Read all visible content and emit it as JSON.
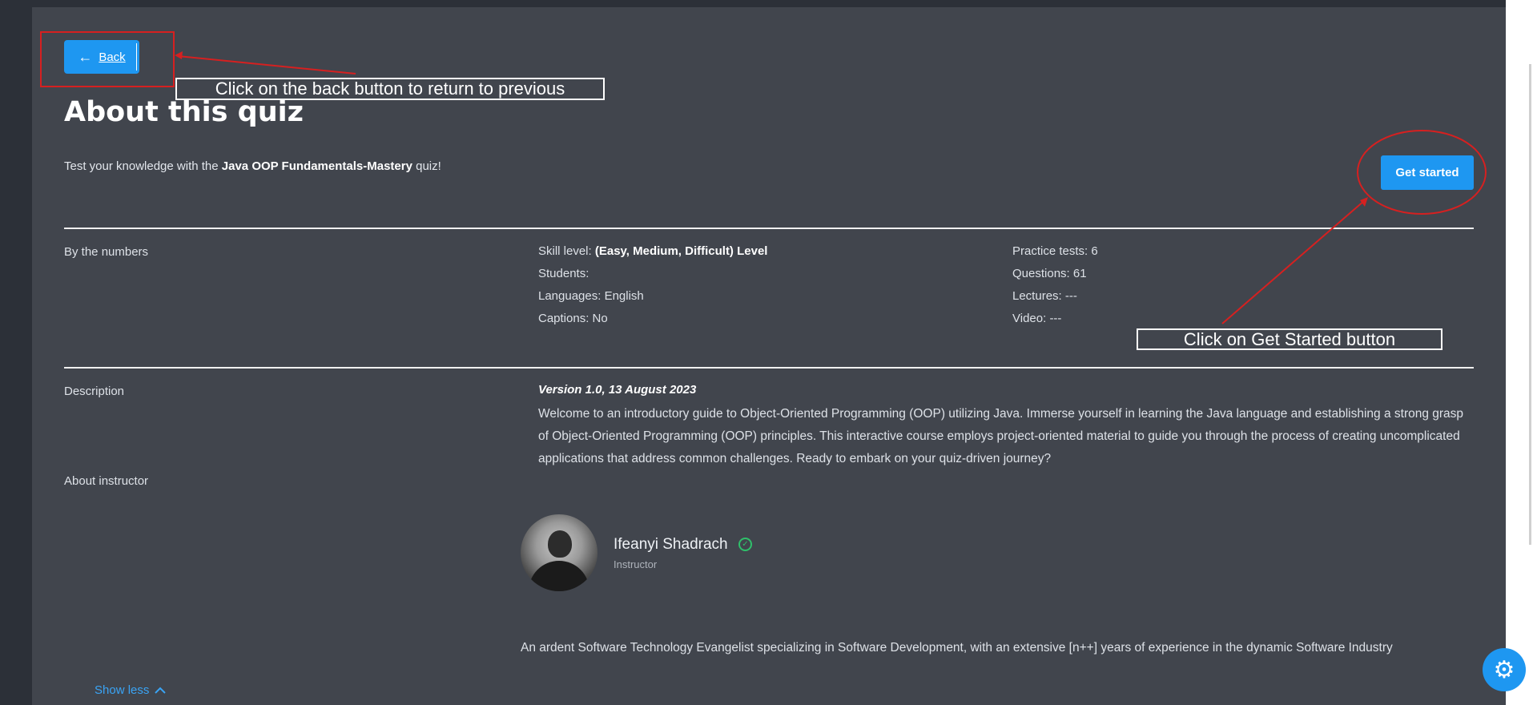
{
  "back_button": {
    "label": "Back",
    "icon": "arrow-left-icon"
  },
  "page": {
    "title": "About this quiz",
    "intro_prefix": "Test your knowledge with the ",
    "intro_quiz_name": "Java OOP Fundamentals-Mastery",
    "intro_suffix": " quiz!",
    "get_started_label": "Get started"
  },
  "numbers": {
    "section_label": "By the numbers",
    "col1": [
      {
        "label": "Skill level: ",
        "value": "(Easy, Medium, Difficult) Level",
        "bold": true
      },
      {
        "label": "Students: ",
        "value": ""
      },
      {
        "label": "Languages: ",
        "value": "English"
      },
      {
        "label": "Captions: ",
        "value": "No"
      }
    ],
    "col2": [
      {
        "label": "Practice tests: ",
        "value": "6"
      },
      {
        "label": "Questions: ",
        "value": "61"
      },
      {
        "label": "Lectures: ",
        "value": "---"
      },
      {
        "label": "Video: ",
        "value": "---"
      }
    ]
  },
  "description": {
    "section_label": "Description",
    "version": "Version 1.0, 13 August 2023",
    "text": "Welcome to an introductory guide to Object-Oriented Programming (OOP) utilizing Java. Immerse yourself in learning the Java language and establishing a strong grasp of Object-Oriented Programming (OOP) principles. This interactive course employs project-oriented material to guide you through the process of creating uncomplicated applications that address common challenges. Ready to embark on your quiz-driven journey?"
  },
  "instructor": {
    "section_label": "About instructor",
    "name": "Ifeanyi Shadrach",
    "role": "Instructor",
    "verified_icon": "check-circle-icon",
    "bio": "An ardent Software Technology Evangelist specializing in Software Development, with an extensive [n++] years of experience in the dynamic Software Industry"
  },
  "show_less_label": "Show less",
  "settings_icon": "gear-icon",
  "annotations": {
    "back_note": "Click on the back button to return to previous",
    "get_started_note": "Click on Get Started button",
    "color": "#d62020"
  }
}
